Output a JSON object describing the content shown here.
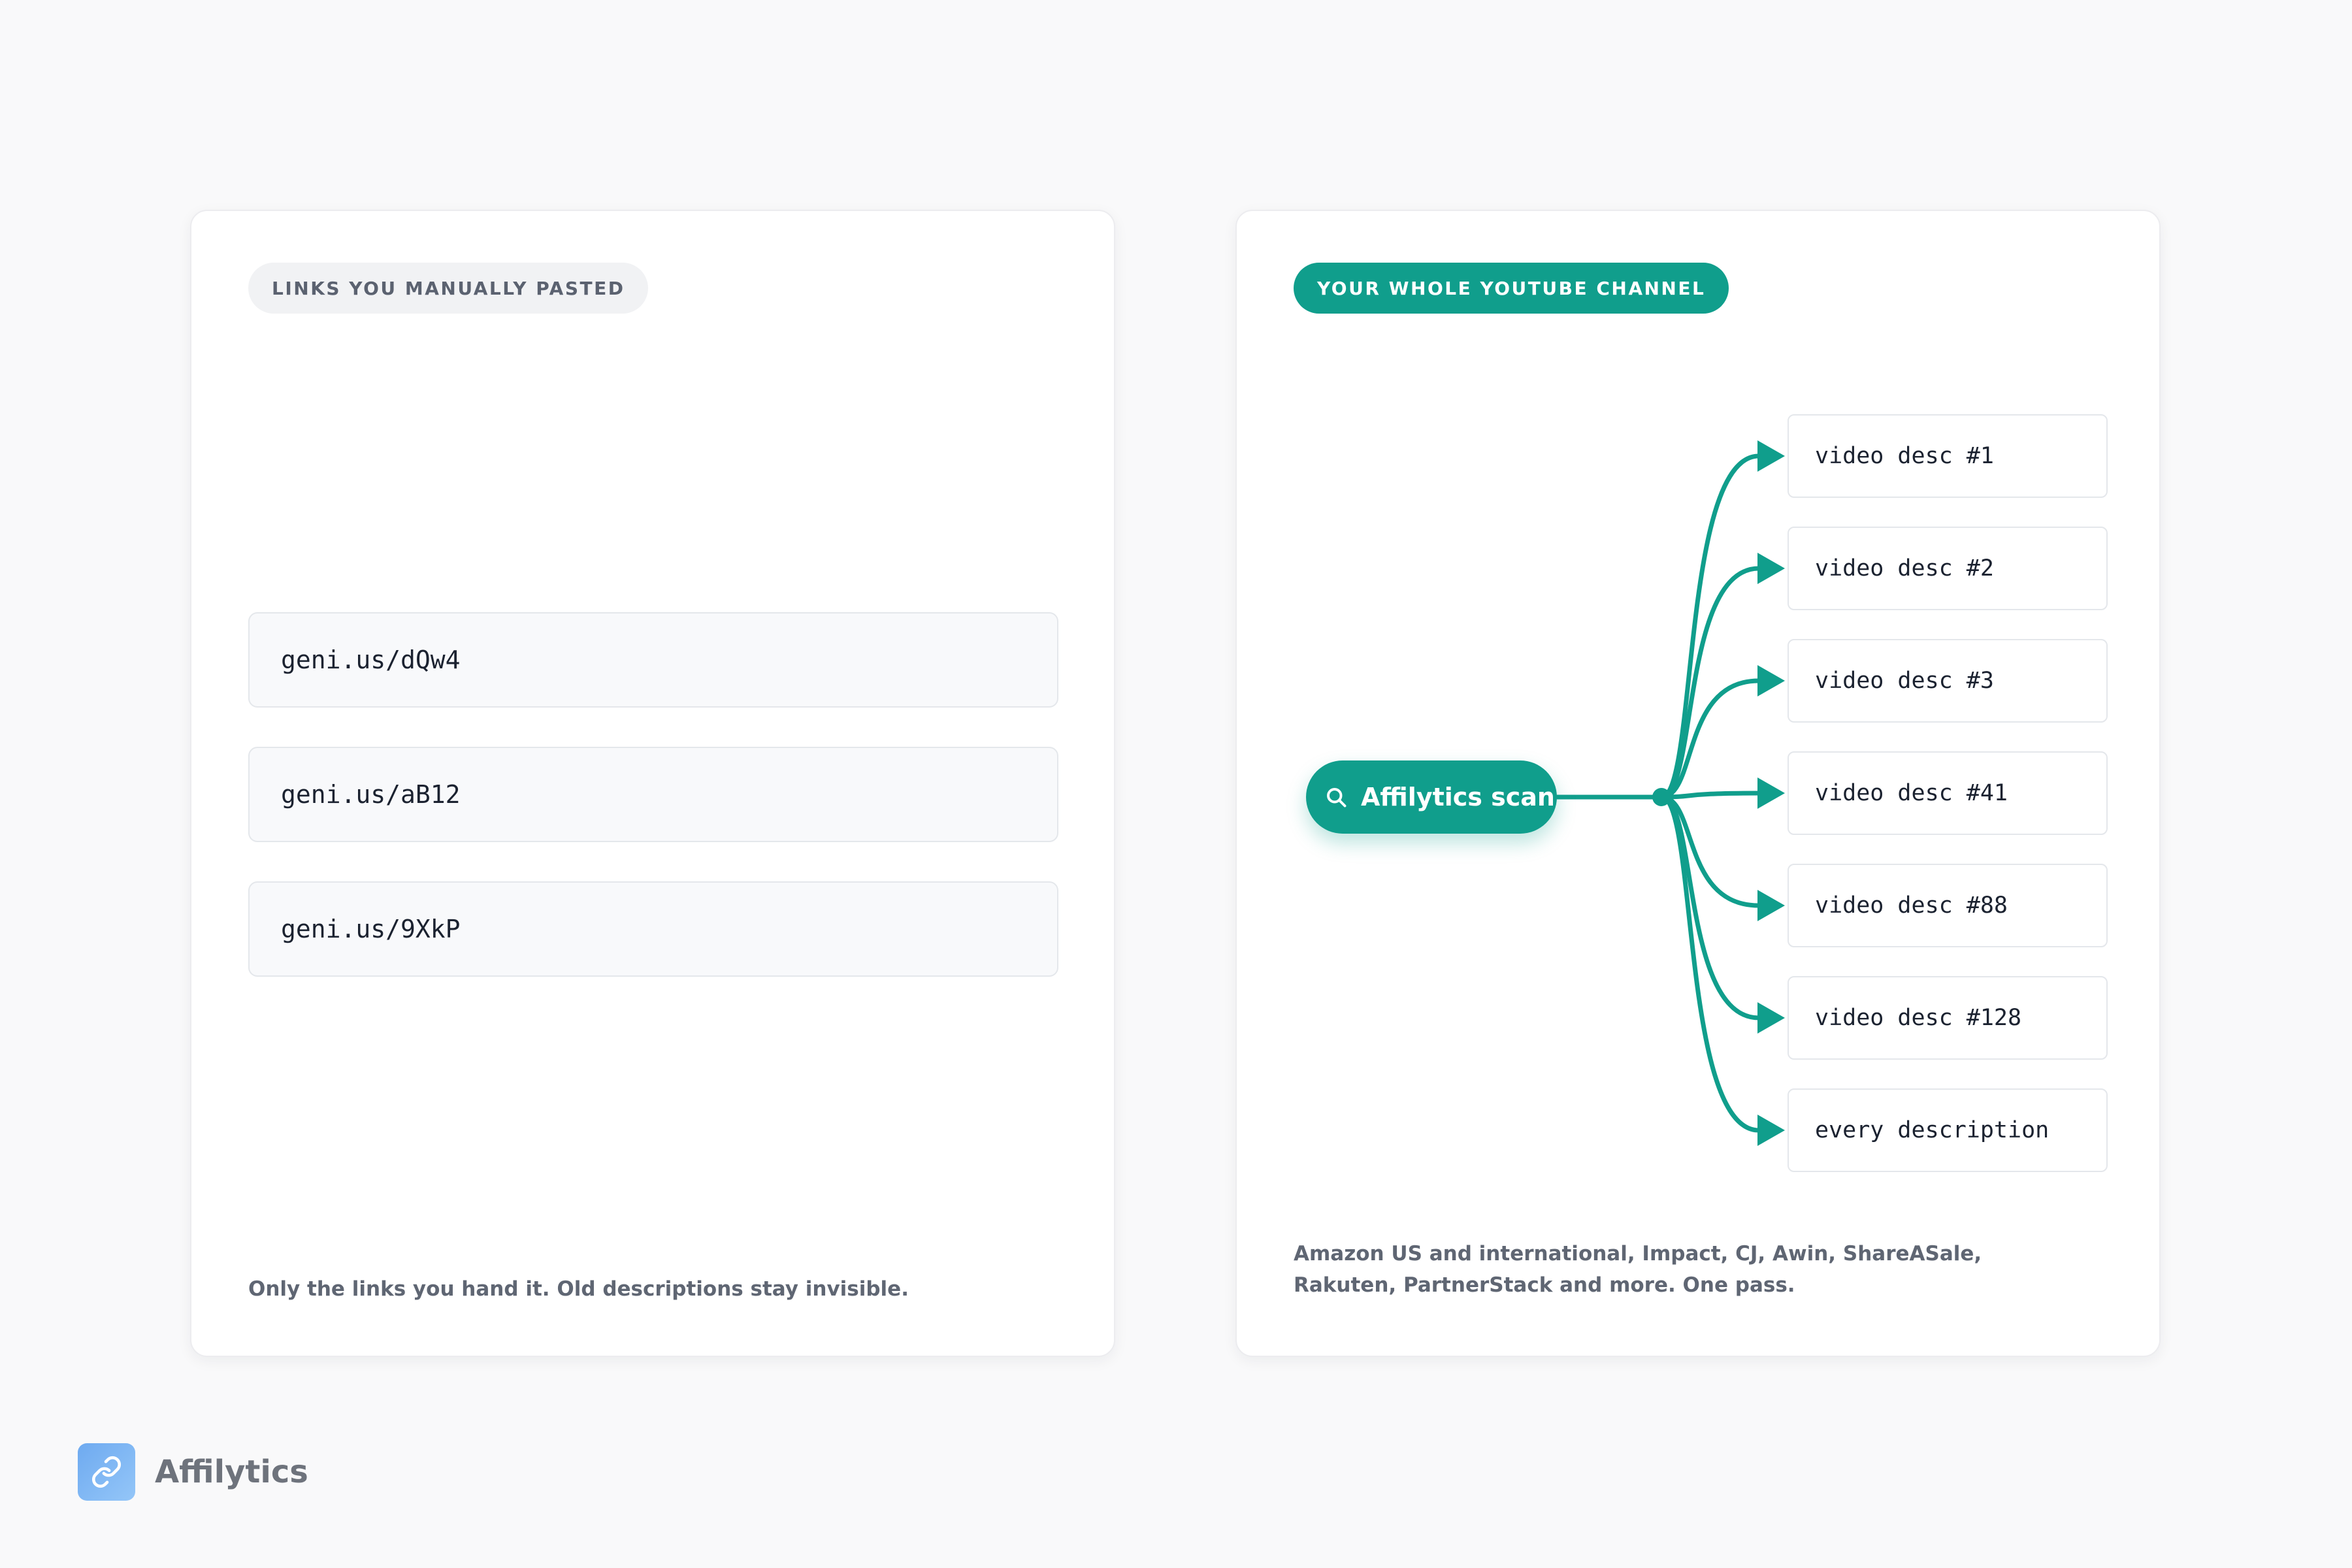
{
  "left_panel": {
    "badge": "LINKS YOU MANUALLY PASTED",
    "links": [
      "geni.us/dQw4",
      "geni.us/aB12",
      "geni.us/9XkP"
    ],
    "caption": "Only the links you hand it. Old descriptions stay invisible."
  },
  "right_panel": {
    "badge": "YOUR WHOLE YOUTUBE CHANNEL",
    "scan_button": {
      "label": "Affilytics scan",
      "icon": "search-icon"
    },
    "targets": [
      "video desc #1",
      "video desc #2",
      "video desc #3",
      "video desc #41",
      "video desc #88",
      "video desc #128",
      "every description"
    ],
    "caption": "Amazon US and international, Impact, CJ, Awin, ShareASale, Rakuten, PartnerStack and more. One pass."
  },
  "brand": {
    "name": "Affilytics",
    "icon": "link-icon"
  },
  "colors": {
    "accent": "#109e8c",
    "background": "#f9f9fa",
    "card": "#ffffff",
    "muted_text": "#5f6673",
    "brand_logo": "#7ab4f3"
  }
}
